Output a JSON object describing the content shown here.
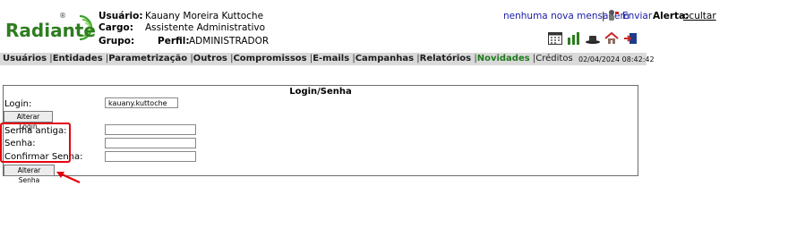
{
  "logo": {
    "text": "Radiante",
    "registered": "®"
  },
  "user": {
    "usuario_label": "Usuário:",
    "usuario_value": "Kauany Moreira Kuttoche",
    "cargo_label": "Cargo:",
    "cargo_value": "Assistente Administrativo",
    "grupo_label": "Grupo:",
    "perfil_label": "Perfil:",
    "perfil_value": "ADMINISTRADOR"
  },
  "topbar": {
    "messages_link": "nenhuma nova mensagem",
    "separator": "|",
    "send_link": "Enviar",
    "alert_label": "Alerta:",
    "alert_link": "ocultar"
  },
  "icons": [
    "calendar-icon",
    "bar-chart-icon",
    "hat-icon",
    "home-icon",
    "exit-door-icon"
  ],
  "menu": [
    {
      "label": "Usuários",
      "style": "bold"
    },
    {
      "label": "Entidades",
      "style": "bold"
    },
    {
      "label": "Parametrização",
      "style": "bold"
    },
    {
      "label": "Outros",
      "style": "bold"
    },
    {
      "label": "Compromissos",
      "style": "bold"
    },
    {
      "label": "E-mails",
      "style": "bold"
    },
    {
      "label": "Campanhas",
      "style": "bold"
    },
    {
      "label": "Relatórios",
      "style": "bold"
    },
    {
      "label": "Novidades",
      "style": "active"
    },
    {
      "label": "Créditos",
      "style": "normal"
    }
  ],
  "datetime": "02/04/2024 08:42:42",
  "form": {
    "title": "Login/Senha",
    "login_label": "Login:",
    "login_value": "kauany.kuttoche",
    "alterar_login_button": "Alterar Login",
    "senha_antiga_label": "Senha antiga:",
    "senha_label": "Senha:",
    "confirmar_label": "Confirmar Senha:",
    "alterar_senha_button": "Alterar Senha"
  },
  "colors": {
    "brand_green": "#2e7d20",
    "highlight_red": "#e3000f",
    "link_blue": "#1a1aa6",
    "menu_bg": "#d9d9d9"
  }
}
